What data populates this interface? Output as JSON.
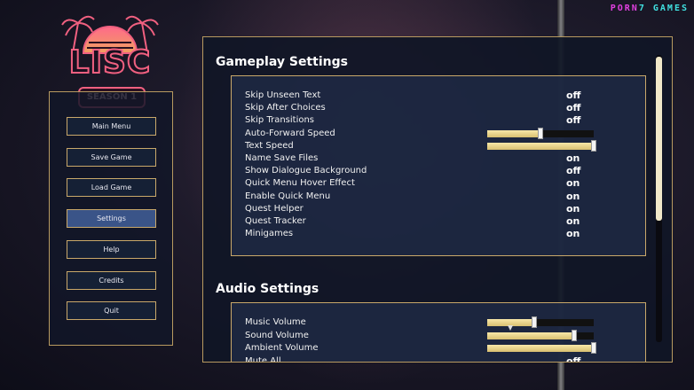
{
  "brand": {
    "part1": "PORN",
    "part2": "7 GAMES"
  },
  "logo": {
    "title": "LISC",
    "subtitle": "SEASON 1"
  },
  "menu": [
    {
      "label": "Main Menu",
      "name": "main-menu-button",
      "active": false
    },
    {
      "label": "Save Game",
      "name": "save-game-button",
      "active": false
    },
    {
      "label": "Load Game",
      "name": "load-game-button",
      "active": false
    },
    {
      "label": "Settings",
      "name": "settings-button",
      "active": true
    },
    {
      "label": "Help",
      "name": "help-button",
      "active": false
    },
    {
      "label": "Credits",
      "name": "credits-button",
      "active": false
    },
    {
      "label": "Quit",
      "name": "quit-button",
      "active": false
    }
  ],
  "gameplay": {
    "title": "Gameplay Settings",
    "rows": [
      {
        "label": "Skip Unseen Text",
        "value": "off"
      },
      {
        "label": "Skip After Choices",
        "value": "off"
      },
      {
        "label": "Skip Transitions",
        "value": "off"
      },
      {
        "label": "Auto-Forward Speed",
        "slider": 0.5
      },
      {
        "label": "Text Speed",
        "slider": 1.0
      },
      {
        "label": "Name Save Files",
        "value": "on"
      },
      {
        "label": "Show Dialogue Background",
        "value": "off"
      },
      {
        "label": "Quick Menu Hover Effect",
        "value": "on"
      },
      {
        "label": "Enable Quick Menu",
        "value": "on"
      },
      {
        "label": "Quest Helper",
        "value": "on"
      },
      {
        "label": "Quest Tracker",
        "value": "on"
      },
      {
        "label": "Minigames",
        "value": "on"
      }
    ]
  },
  "audio": {
    "title": "Audio Settings",
    "rows": [
      {
        "label": "Music Volume",
        "slider": 0.44
      },
      {
        "label": "Sound Volume",
        "slider": 0.82
      },
      {
        "label": "Ambient Volume",
        "slider": 1.0
      },
      {
        "label": "Mute All",
        "value": "off"
      }
    ]
  },
  "scroll": {
    "position": 0.0,
    "visible_fraction": 0.57
  },
  "colors": {
    "accent_gold": "#c9a86a",
    "active_button": "#3a5488",
    "slider_fill": "#e8d490"
  }
}
